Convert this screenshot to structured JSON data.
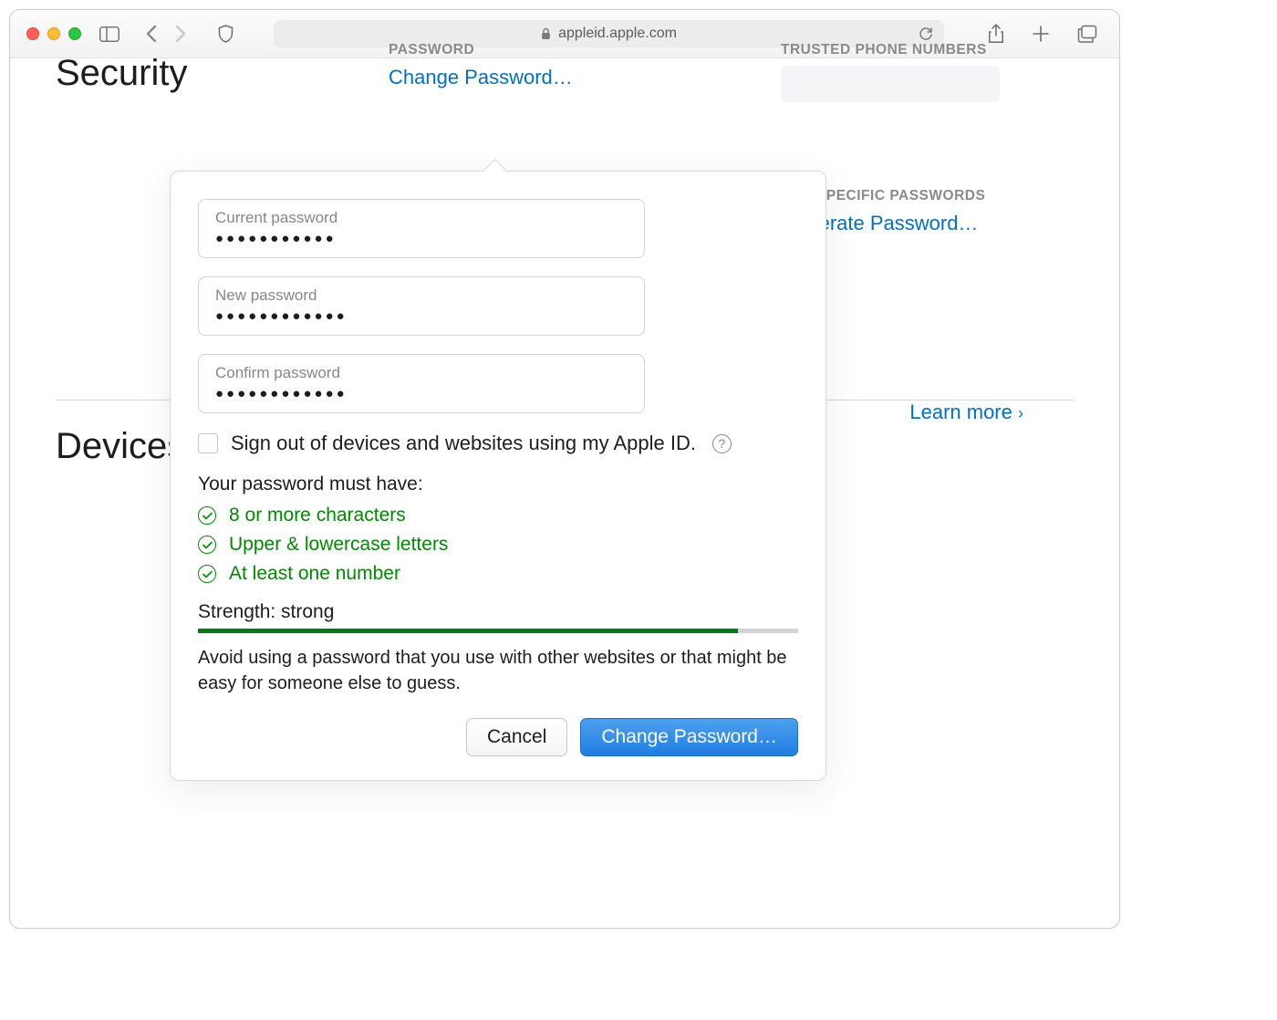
{
  "browser": {
    "url": "appleid.apple.com"
  },
  "page": {
    "security_heading": "Security",
    "devices_heading": "Devices",
    "password_label": "PASSWORD",
    "change_password_link": "Change Password…",
    "trusted_label": "TRUSTED PHONE NUMBERS",
    "app_specific_label": "APP-SPECIFIC PASSWORDS",
    "generate_link": "Generate Password…",
    "learn_more": "Learn more"
  },
  "popover": {
    "fields": {
      "current_label": "Current password",
      "current_value": "●●●●●●●●●●●",
      "new_label": "New password",
      "new_value": "●●●●●●●●●●●●",
      "confirm_label": "Confirm password",
      "confirm_value": "●●●●●●●●●●●●"
    },
    "signout_label": "Sign out of devices and websites using my Apple ID.",
    "requirements_title": "Your password must have:",
    "requirements": {
      "r1": "8 or more characters",
      "r2": "Upper & lowercase letters",
      "r3": "At least one number"
    },
    "strength_label": "Strength: strong",
    "advice": "Avoid using a password that you use with other websites or that might be easy for someone else to guess.",
    "cancel_label": "Cancel",
    "submit_label": "Change Password…"
  }
}
